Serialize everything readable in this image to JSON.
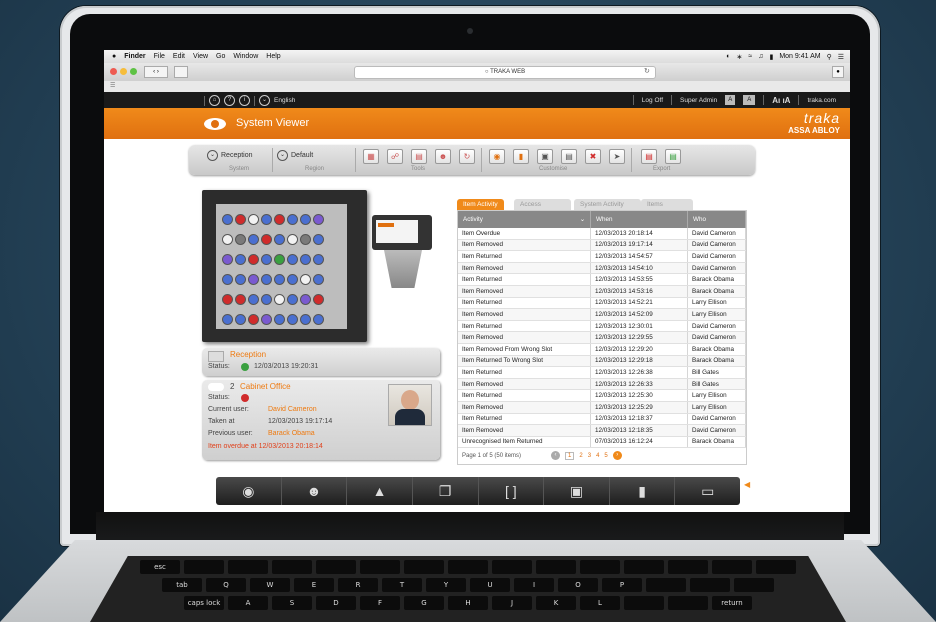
{
  "macMenu": {
    "apple": "",
    "items": [
      "Finder",
      "File",
      "Edit",
      "View",
      "Go",
      "Window",
      "Help"
    ],
    "clock": "Mon 9:41 AM"
  },
  "browser": {
    "url": "TRAKA WEB"
  },
  "appTop": {
    "language": "English",
    "logoff": "Log Off",
    "user": "Super Admin",
    "textSizeSmall": "A",
    "textSizeLarge": "A",
    "fontToggle": "Aı ıA",
    "site": "traka.com"
  },
  "header": {
    "title": "System Viewer",
    "brandName": "traka",
    "brandSub": "ASSA ABLOY"
  },
  "toolbar": {
    "system_value": "Reception",
    "system_label": "System",
    "region_value": "Default",
    "region_label": "Region",
    "tools_label": "Tools",
    "customise_label": "Customise",
    "export_label": "Export"
  },
  "cabinet": {
    "rows": [
      [
        "blue",
        "red",
        "white",
        "blue",
        "red",
        "blue",
        "blue",
        "purple"
      ],
      [
        "white",
        "grey",
        "blue",
        "red",
        "blue",
        "white",
        "grey",
        "blue"
      ],
      [
        "purple",
        "blue",
        "red",
        "blue",
        "green",
        "blue",
        "blue",
        "blue"
      ],
      [
        "blue",
        "blue",
        "purple",
        "blue",
        "blue",
        "blue",
        "white",
        "blue"
      ],
      [
        "red",
        "red",
        "blue",
        "blue",
        "white",
        "blue",
        "purple",
        "red"
      ],
      [
        "blue",
        "blue",
        "red",
        "purple",
        "blue",
        "blue",
        "blue",
        "blue"
      ]
    ],
    "colors": {
      "blue": "#4a6fd0",
      "red": "#d02b2b",
      "white": "#f2f2f2",
      "grey": "#7a7a7a",
      "purple": "#7a5ad0",
      "green": "#3aa040"
    }
  },
  "receptionCard": {
    "name": "Reception",
    "status_label": "Status:",
    "status_time": "12/03/2013 19:20:31"
  },
  "itemCard": {
    "number": "2",
    "name": "Cabinet Office",
    "status_label": "Status:",
    "current_user_label": "Current user:",
    "current_user": "David Cameron",
    "taken_at_label": "Taken at",
    "taken_at": "12/03/2013 19:17:14",
    "previous_user_label": "Previous user:",
    "previous_user": "Barack Obama",
    "overdue": "Item overdue at 12/03/2013 20:18:14"
  },
  "tabs": [
    "Item Activity",
    "Access",
    "System Activity",
    "Items"
  ],
  "table": {
    "headers": [
      "Activity",
      "When",
      "Who"
    ],
    "rows": [
      [
        "Item Overdue",
        "12/03/2013 20:18:14",
        "David Cameron"
      ],
      [
        "Item Removed",
        "12/03/2013 19:17:14",
        "David Cameron"
      ],
      [
        "Item Returned",
        "12/03/2013 14:54:57",
        "David Cameron"
      ],
      [
        "Item Removed",
        "12/03/2013 14:54:10",
        "David Cameron"
      ],
      [
        "Item Returned",
        "12/03/2013 14:53:55",
        "Barack Obama"
      ],
      [
        "Item Removed",
        "12/03/2013 14:53:16",
        "Barack Obama"
      ],
      [
        "Item Returned",
        "12/03/2013 14:52:21",
        "Larry Ellison"
      ],
      [
        "Item Removed",
        "12/03/2013 14:52:09",
        "Larry Ellison"
      ],
      [
        "Item Returned",
        "12/03/2013 12:30:01",
        "David Cameron"
      ],
      [
        "Item Removed",
        "12/03/2013 12:29:55",
        "David Cameron"
      ],
      [
        "Item Removed From Wrong Slot",
        "12/03/2013 12:29:20",
        "Barack Obama"
      ],
      [
        "Item Returned To Wrong Slot",
        "12/03/2013 12:29:18",
        "Barack Obama"
      ],
      [
        "Item Returned",
        "12/03/2013 12:26:38",
        "Bill Gates"
      ],
      [
        "Item Removed",
        "12/03/2013 12:26:33",
        "Bill Gates"
      ],
      [
        "Item Returned",
        "12/03/2013 12:25:30",
        "Larry Ellison"
      ],
      [
        "Item Removed",
        "12/03/2013 12:25:29",
        "Larry Ellison"
      ],
      [
        "Item Returned",
        "12/03/2013 12:18:37",
        "David Cameron"
      ],
      [
        "Item Removed",
        "12/03/2013 12:18:35",
        "David Cameron"
      ],
      [
        "Unrecognised Item Returned",
        "07/03/2013 16:12:24",
        "Barack Obama"
      ]
    ]
  },
  "pager": {
    "info": "Page 1 of 5 (50 items)",
    "pages": [
      "1",
      "2",
      "3",
      "4",
      "5"
    ]
  },
  "keyboard": {
    "row1": [
      "esc",
      "",
      "",
      "",
      "",
      "",
      "",
      "",
      "",
      "",
      "",
      "",
      "",
      "",
      ""
    ],
    "row2": [
      "tab",
      "Q",
      "W",
      "E",
      "R",
      "T",
      "Y",
      "U",
      "I",
      "O",
      "P",
      "",
      "",
      ""
    ],
    "row3": [
      "caps lock",
      "A",
      "S",
      "D",
      "F",
      "G",
      "H",
      "J",
      "K",
      "L",
      "",
      "",
      "return"
    ]
  }
}
